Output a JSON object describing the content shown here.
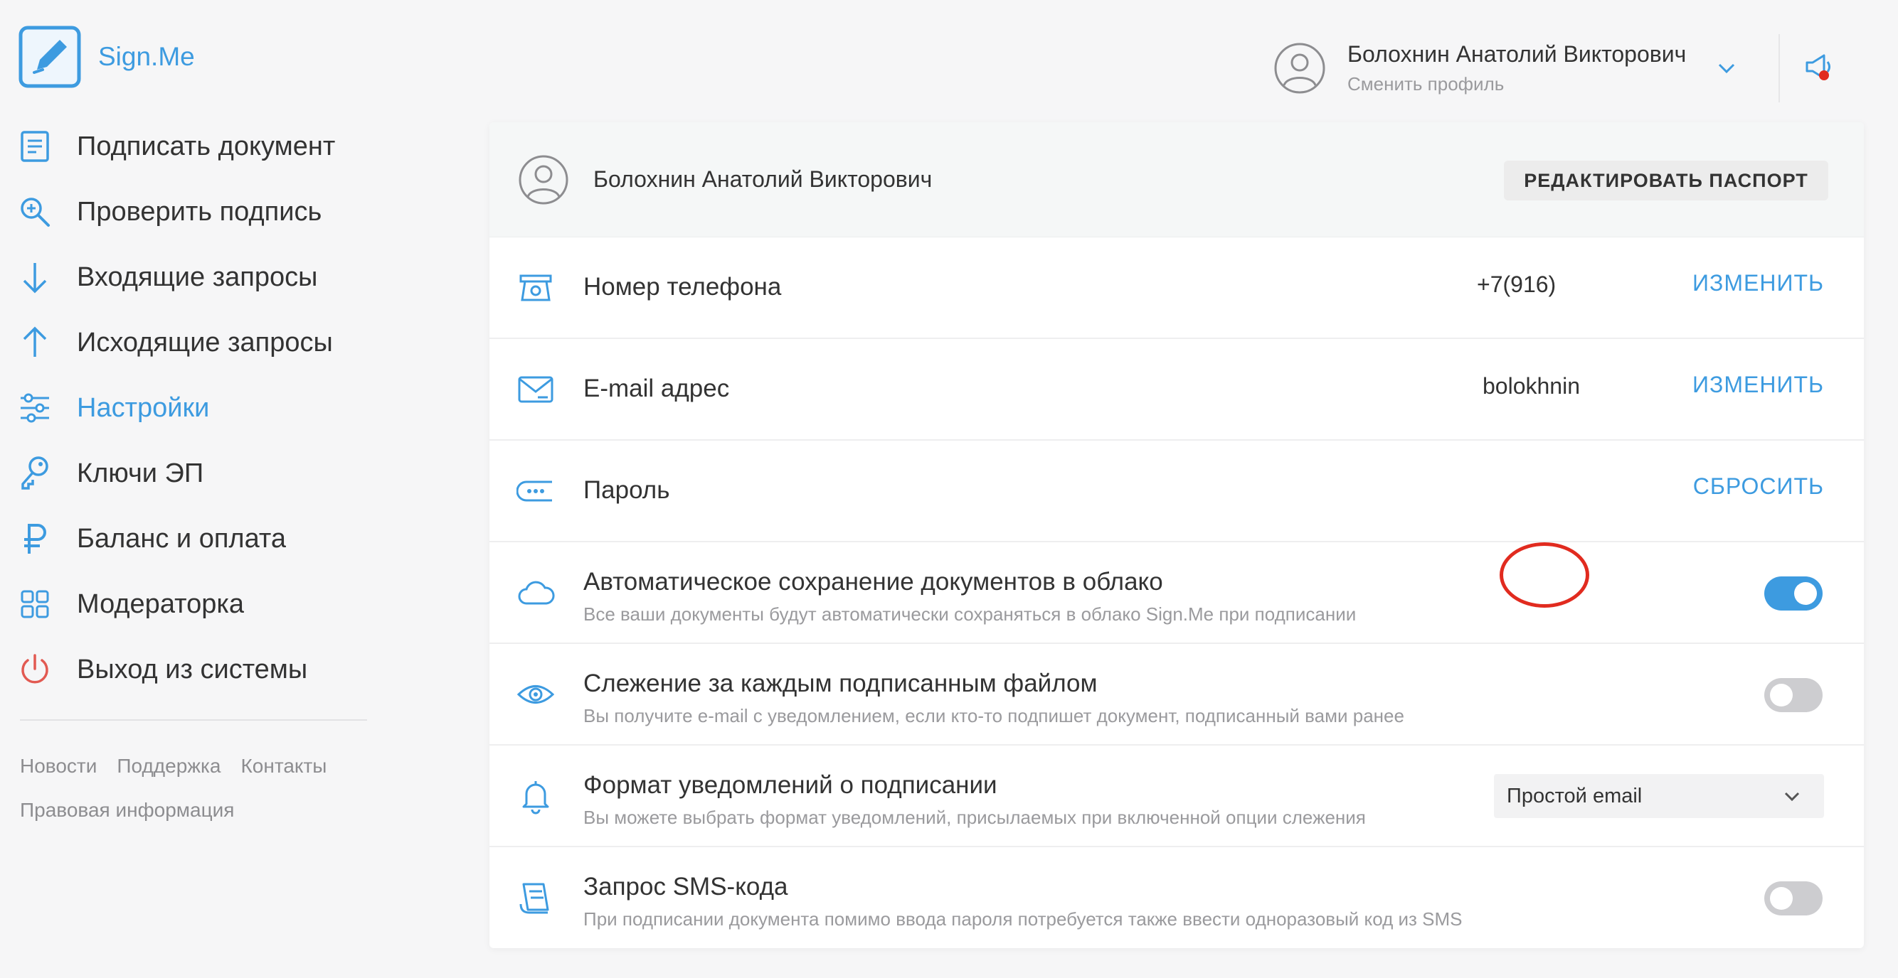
{
  "brand": {
    "name": "Sign.Me"
  },
  "sidebar": {
    "items": [
      {
        "label": "Подписать документ",
        "icon": "document-icon",
        "active": false
      },
      {
        "label": "Проверить подпись",
        "icon": "magnify-plus-icon",
        "active": false
      },
      {
        "label": "Входящие запросы",
        "icon": "arrow-down-icon",
        "active": false
      },
      {
        "label": "Исходящие запросы",
        "icon": "arrow-up-icon",
        "active": false
      },
      {
        "label": "Настройки",
        "icon": "sliders-icon",
        "active": true
      },
      {
        "label": "Ключи ЭП",
        "icon": "key-icon",
        "active": false
      },
      {
        "label": "Баланс и оплата",
        "icon": "ruble-icon",
        "active": false
      },
      {
        "label": "Модераторка",
        "icon": "grid-icon",
        "active": false
      },
      {
        "label": "Выход из системы",
        "icon": "power-icon",
        "active": false
      }
    ],
    "footer": {
      "news": "Новости",
      "support": "Поддержка",
      "contacts": "Контакты",
      "legal": "Правовая информация"
    }
  },
  "header": {
    "user_name": "Болохнин Анатолий Викторович",
    "switch_profile": "Сменить профиль"
  },
  "panel": {
    "user_name": "Болохнин Анатолий Викторович",
    "edit_passport": "РЕДАКТИРОВАТЬ ПАСПОРТ",
    "phone": {
      "title": "Номер телефона",
      "value": "+7(916)",
      "action": "ИЗМЕНИТЬ"
    },
    "email": {
      "title": "E-mail адрес",
      "value": "bolokhnin",
      "action": "ИЗМЕНИТЬ"
    },
    "password": {
      "title": "Пароль",
      "action": "СБРОСИТЬ"
    },
    "autosave": {
      "title": "Автоматическое сохранение документов в облако",
      "subtitle": "Все ваши документы будут автоматически сохраняться в облако Sign.Me при подписании",
      "enabled": true
    },
    "tracking": {
      "title": "Слежение за каждым подписанным файлом",
      "subtitle": "Вы получите e-mail с уведомлением, если кто-то подпишет документ, подписанный вами ранее",
      "enabled": false
    },
    "notify_format": {
      "title": "Формат уведомлений о подписании",
      "subtitle": "Вы можете выбрать формат уведомлений, присылаемых при включенной опции слежения",
      "selected": "Простой email"
    },
    "sms": {
      "title": "Запрос SMS-кода",
      "subtitle": "При подписании документа помимо ввода пароля потребуется также ввести одноразовый код из SMS",
      "enabled": false
    }
  },
  "colors": {
    "accent": "#3d9be0",
    "danger": "#e25a52",
    "highlight": "#e12b1f"
  }
}
